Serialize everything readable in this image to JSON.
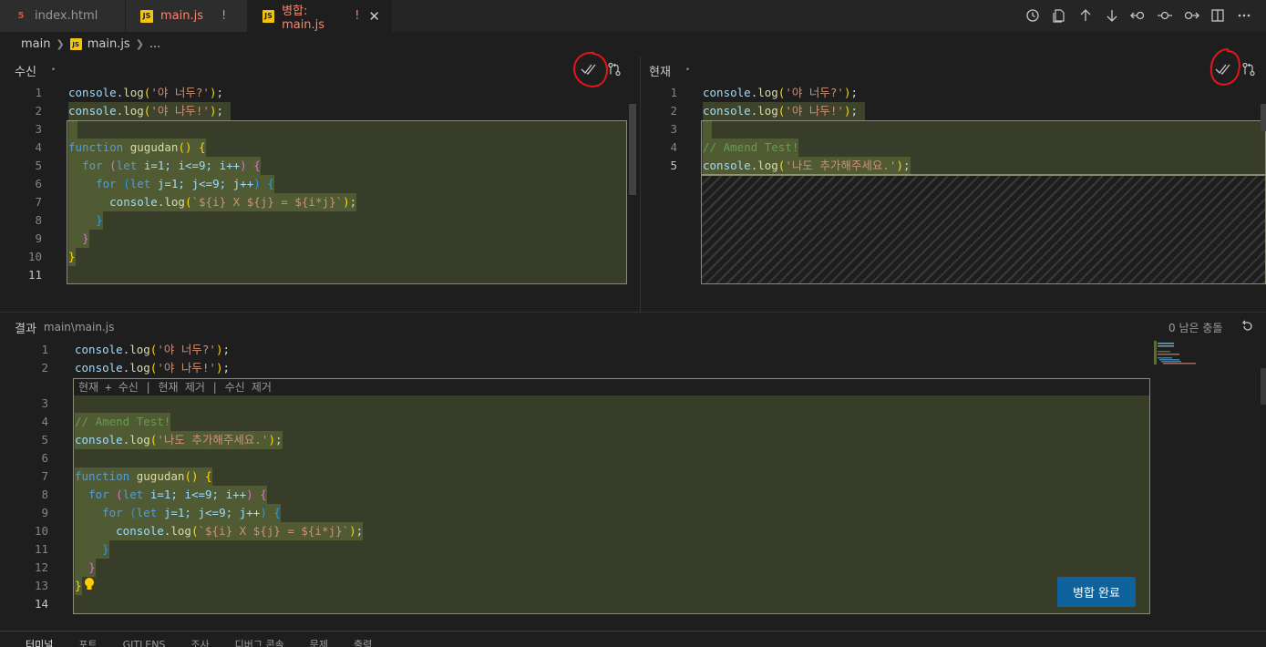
{
  "tabs": [
    {
      "label": "index.html",
      "icon": "html5-icon"
    },
    {
      "label": "main.js",
      "icon": "js-icon",
      "status": "!"
    },
    {
      "label": "병합: main.js",
      "icon": "js-icon",
      "status": "!",
      "close": "✕"
    }
  ],
  "breadcrumb": {
    "folder": "main",
    "file": "main.js",
    "more": "..."
  },
  "incoming": {
    "title": "수신",
    "dot": "•"
  },
  "current": {
    "title": "현재",
    "dot": "•"
  },
  "result": {
    "title": "결과",
    "path": "main\\main.js",
    "conflicts": "0 남은 충돌"
  },
  "codelens": "현재 + 수신 | 현재 제거 | 수신 제거",
  "merge_button": "병합 완료",
  "line_numbers": {
    "incoming": [
      "1",
      "2",
      "3",
      "4",
      "5",
      "6",
      "7",
      "8",
      "9",
      "10",
      "11"
    ],
    "current": [
      "1",
      "2",
      "3",
      "4",
      "5"
    ],
    "result": [
      "1",
      "2",
      "3",
      "4",
      "5",
      "6",
      "7",
      "8",
      "9",
      "10",
      "11",
      "12",
      "13",
      "14"
    ]
  },
  "code": {
    "l1": {
      "obj": "console",
      "fn": "log",
      "str": "'야 너두?'"
    },
    "l2": {
      "obj": "console",
      "fn": "log",
      "str": "'야 나두!'"
    },
    "fn_kw": "function",
    "fn_name": "gugudan",
    "for_kw": "for",
    "let_kw": "let",
    "loop_i": "i=1; i<=9; i++",
    "loop_j": "j=1; j<=9; j++",
    "tpl": "`${i} X ${j} = ${i*j}`",
    "comment": "// Amend Test!",
    "add_str": "'나도 추가해주세요.'"
  },
  "bottom_tabs": [
    "터미널",
    "포트",
    "GITLENS",
    "조사",
    "디버그 콘솔",
    "문제",
    "출력"
  ]
}
